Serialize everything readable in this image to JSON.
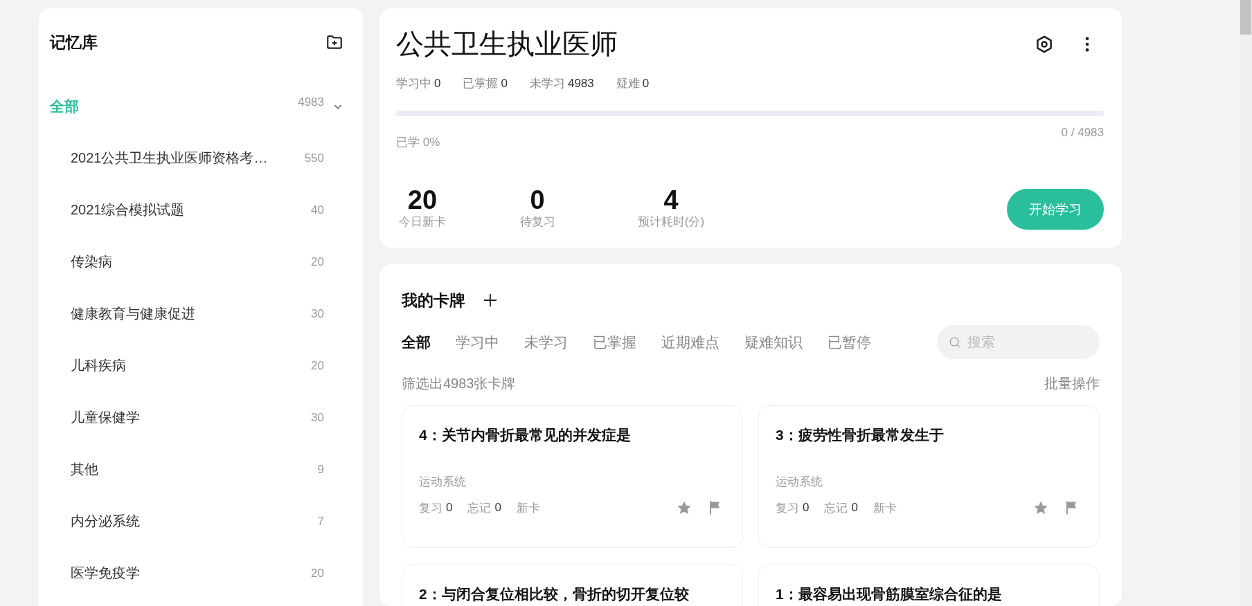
{
  "sidebar": {
    "title": "记忆库",
    "items": [
      {
        "label": "全部",
        "count": "4983",
        "selected": true,
        "expanded": true,
        "children": [
          {
            "label": "2021公共卫生执业医师资格考…",
            "count": "550",
            "selected": false
          },
          {
            "label": "2021综合模拟试题",
            "count": "40",
            "selected": false
          },
          {
            "label": "传染病",
            "count": "20",
            "selected": false
          },
          {
            "label": "健康教育与健康促进",
            "count": "30",
            "selected": false
          },
          {
            "label": "儿科疾病",
            "count": "20",
            "selected": false
          },
          {
            "label": "儿童保健学",
            "count": "30",
            "selected": false
          },
          {
            "label": "其他",
            "count": "9",
            "selected": false
          },
          {
            "label": "内分泌系统",
            "count": "7",
            "selected": false
          },
          {
            "label": "医学免疫学",
            "count": "20",
            "selected": false
          }
        ]
      }
    ]
  },
  "deck": {
    "title": "公共卫生执业医师",
    "stats": [
      {
        "label": "学习中",
        "value": "0"
      },
      {
        "label": "已掌握",
        "value": "0"
      },
      {
        "label": "未学习",
        "value": "4983"
      },
      {
        "label": "疑难",
        "value": "0"
      }
    ],
    "progress": {
      "level": 0,
      "label": "已学 0%",
      "reading": "0 / 4983"
    },
    "metrics": [
      {
        "value": "20",
        "label": "今日新卡"
      },
      {
        "value": "0",
        "label": "待复习"
      },
      {
        "value": "4",
        "label": "预计耗时(分)"
      }
    ],
    "start_button": "开始学习"
  },
  "cards_panel": {
    "title": "我的卡牌",
    "tabs": [
      {
        "label": "全部",
        "selected": true
      },
      {
        "label": "学习中",
        "selected": false
      },
      {
        "label": "未学习",
        "selected": false
      },
      {
        "label": "已掌握",
        "selected": false
      },
      {
        "label": "近期难点",
        "selected": false
      },
      {
        "label": "疑难知识",
        "selected": false
      },
      {
        "label": "已暂停",
        "selected": false
      }
    ],
    "search": {
      "placeholder": "搜索"
    },
    "filter_text": "筛选出4983张卡牌",
    "batch_action": "批量操作",
    "cards": [
      {
        "title": "4：关节内骨折最常见的并发症是",
        "tag": "运动系统",
        "review_label": "复习",
        "review": "0",
        "forget_label": "忘记",
        "forget": "0",
        "status": "新卡"
      },
      {
        "title": "3：疲劳性骨折最常发生于",
        "tag": "运动系统",
        "review_label": "复习",
        "review": "0",
        "forget_label": "忘记",
        "forget": "0",
        "status": "新卡"
      },
      {
        "title": "2：与闭合复位相比较，骨折的切开复位较"
      },
      {
        "title": "1：最容易出现骨筋膜室综合征的是"
      }
    ]
  }
}
